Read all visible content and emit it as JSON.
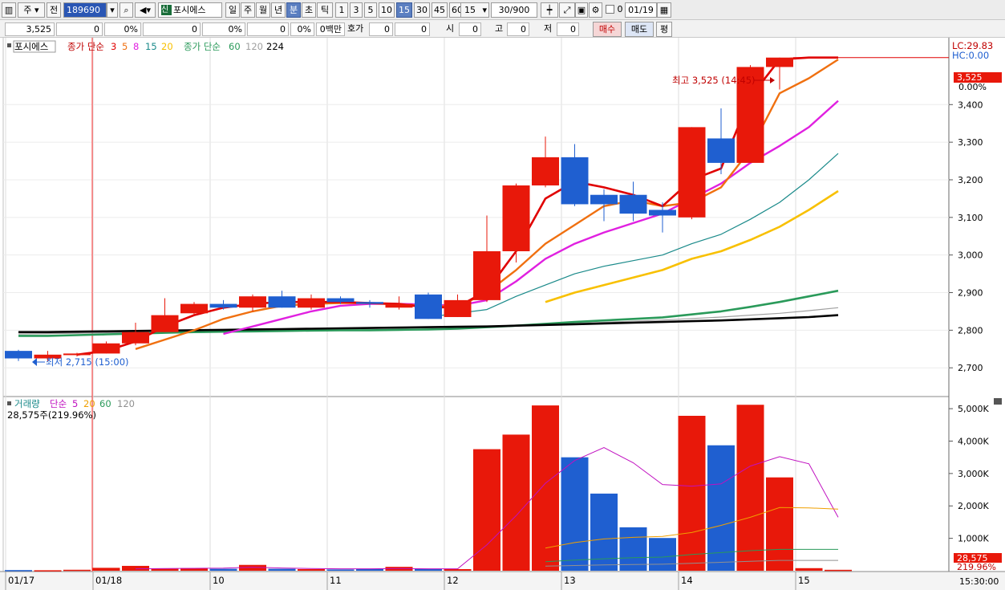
{
  "toolbar": {
    "market": "주",
    "market_mode": "전",
    "code": "189690",
    "name_badge": "신",
    "name": "포시에스",
    "periods": [
      "일",
      "주",
      "월",
      "년",
      "분",
      "초",
      "틱"
    ],
    "active_period": "분",
    "intervals": [
      "1",
      "3",
      "5",
      "10",
      "15",
      "30",
      "45",
      "60"
    ],
    "active_interval": "15",
    "interval_select": "15",
    "count": "30",
    "count_total": "/900",
    "date_checkbox_label": "0",
    "date": "01/19"
  },
  "quote": {
    "price": "3,525",
    "change": "0",
    "change_pct": "0%",
    "volume": "0",
    "volume_pct": "0%",
    "amount": "0",
    "amount_pct": "0%",
    "amount_unit": "0백만",
    "ask_label": "호가",
    "ask_value": "0",
    "ask_value2": "0",
    "open_label": "시",
    "open": "0",
    "high_label": "고",
    "high": "0",
    "low_label": "저",
    "low": "0",
    "buy_label": "매수",
    "sell_label": "매도",
    "eval_label": "평"
  },
  "legend": {
    "stock": "포시에스",
    "ma_short_label": "종가 단순",
    "ma_short_periods": [
      "3",
      "5",
      "8",
      "15",
      "20"
    ],
    "ma_long_label": "종가 단순",
    "ma_long_periods": [
      "60",
      "120",
      "224"
    ],
    "volume_label": "거래량",
    "volume_ma_label": "단순",
    "volume_ma_periods": [
      "5",
      "20",
      "60",
      "120"
    ],
    "volume_current": "28,575주(219.96%)"
  },
  "axis": {
    "lc": "LC:29.83",
    "hc": "HC:0.00",
    "price_tag": "3,525",
    "pct_tag": "0.00%",
    "volume_tag": "28,575",
    "volume_pct_tag": "219.96%",
    "time_tag": "15:30:00"
  },
  "annotations": {
    "high": "최고 3,525 (14:45)",
    "low": "최저 2,715 (15:00)"
  },
  "colors": {
    "up": "#e8180a",
    "down": "#1f5fd0",
    "ma3": "#e00000",
    "ma5": "#f07010",
    "ma8": "#e020e0",
    "ma15": "#1a8a8a",
    "ma20": "#f8c000",
    "ma60": "#2a9a5a",
    "ma120": "#a0a0a0",
    "ma224": "#000000"
  },
  "chart_data": {
    "type": "candlestick",
    "price_axis": {
      "ylim": [
        2630,
        3565
      ],
      "ticks": [
        2700,
        2800,
        2900,
        3000,
        3100,
        3200,
        3300,
        3400
      ]
    },
    "volume_axis": {
      "ylim": [
        0,
        5300
      ],
      "unit": "K",
      "ticks": [
        1000,
        2000,
        3000,
        4000,
        5000
      ]
    },
    "date_labels": [
      {
        "label": "01/17",
        "index": -0.5
      },
      {
        "label": "01/18",
        "index": 2.5
      },
      {
        "label": "10",
        "index": 6.5
      },
      {
        "label": "11",
        "index": 10.5
      },
      {
        "label": "12",
        "index": 14.5
      },
      {
        "label": "13",
        "index": 18.5
      },
      {
        "label": "14",
        "index": 22.5
      },
      {
        "label": "15",
        "index": 26.5
      }
    ],
    "candles": [
      {
        "o": 2745,
        "h": 2748,
        "l": 2718,
        "c": 2725
      },
      {
        "o": 2725,
        "h": 2745,
        "l": 2718,
        "c": 2735
      },
      {
        "o": 2735,
        "h": 2740,
        "l": 2730,
        "c": 2738
      },
      {
        "o": 2738,
        "h": 2770,
        "l": 2738,
        "c": 2765
      },
      {
        "o": 2765,
        "h": 2820,
        "l": 2760,
        "c": 2795
      },
      {
        "o": 2795,
        "h": 2885,
        "l": 2795,
        "c": 2840
      },
      {
        "o": 2845,
        "h": 2875,
        "l": 2840,
        "c": 2870
      },
      {
        "o": 2870,
        "h": 2880,
        "l": 2855,
        "c": 2860
      },
      {
        "o": 2860,
        "h": 2895,
        "l": 2850,
        "c": 2890
      },
      {
        "o": 2890,
        "h": 2905,
        "l": 2860,
        "c": 2860
      },
      {
        "o": 2860,
        "h": 2895,
        "l": 2855,
        "c": 2885
      },
      {
        "o": 2885,
        "h": 2890,
        "l": 2870,
        "c": 2875
      },
      {
        "o": 2875,
        "h": 2880,
        "l": 2860,
        "c": 2870
      },
      {
        "o": 2860,
        "h": 2890,
        "l": 2855,
        "c": 2870
      },
      {
        "o": 2895,
        "h": 2900,
        "l": 2830,
        "c": 2830
      },
      {
        "o": 2835,
        "h": 2895,
        "l": 2835,
        "c": 2880
      },
      {
        "o": 2880,
        "h": 3105,
        "l": 2875,
        "c": 3010
      },
      {
        "o": 3010,
        "h": 3190,
        "l": 2980,
        "c": 3185
      },
      {
        "o": 3185,
        "h": 3315,
        "l": 3180,
        "c": 3260
      },
      {
        "o": 3260,
        "h": 3295,
        "l": 3130,
        "c": 3135
      },
      {
        "o": 3160,
        "h": 3175,
        "l": 3090,
        "c": 3135
      },
      {
        "o": 3160,
        "h": 3195,
        "l": 3090,
        "c": 3110
      },
      {
        "o": 3120,
        "h": 3140,
        "l": 3060,
        "c": 3105
      },
      {
        "o": 3100,
        "h": 3340,
        "l": 3095,
        "c": 3340
      },
      {
        "o": 3310,
        "h": 3390,
        "l": 3215,
        "c": 3245
      },
      {
        "o": 3245,
        "h": 3505,
        "l": 3245,
        "c": 3500
      },
      {
        "o": 3500,
        "h": 3525,
        "l": 3440,
        "c": 3525
      }
    ],
    "volumes": [
      20,
      15,
      30,
      90,
      150,
      60,
      80,
      60,
      180,
      60,
      50,
      40,
      50,
      120,
      60,
      50,
      3750,
      4200,
      5100,
      3500,
      2380,
      1340,
      1010,
      4780,
      3870,
      5120,
      2880,
      80,
      28.575
    ],
    "ma": [
      {
        "period": 3,
        "values": [
          null,
          null,
          2735,
          2745,
          2770,
          2810,
          2840,
          2860,
          2870,
          2875,
          2875,
          2875,
          2872,
          2870,
          2860,
          2862,
          2905,
          3010,
          3150,
          3195,
          3180,
          3160,
          3130,
          3200,
          3230,
          3420,
          3520,
          3525,
          3525
        ]
      },
      {
        "period": 5,
        "values": [
          null,
          null,
          null,
          null,
          2750,
          2775,
          2800,
          2830,
          2850,
          2865,
          2870,
          2872,
          2872,
          2868,
          2865,
          2862,
          2900,
          2960,
          3030,
          3080,
          3130,
          3145,
          3130,
          3140,
          3180,
          3280,
          3430,
          3470,
          3520
        ]
      },
      {
        "period": 8,
        "values": [
          null,
          null,
          null,
          null,
          null,
          null,
          null,
          2790,
          2810,
          2830,
          2850,
          2865,
          2870,
          2870,
          2868,
          2865,
          2880,
          2930,
          2990,
          3030,
          3060,
          3085,
          3110,
          3150,
          3190,
          3245,
          3290,
          3340,
          3410
        ]
      },
      {
        "period": 15,
        "values": [
          null,
          null,
          null,
          null,
          null,
          null,
          null,
          null,
          null,
          null,
          null,
          null,
          null,
          null,
          2835,
          2845,
          2855,
          2890,
          2920,
          2950,
          2970,
          2985,
          3000,
          3030,
          3055,
          3095,
          3140,
          3200,
          3270
        ]
      },
      {
        "period": 20,
        "values": [
          null,
          null,
          null,
          null,
          null,
          null,
          null,
          null,
          null,
          null,
          null,
          null,
          null,
          null,
          null,
          null,
          null,
          null,
          2875,
          2900,
          2920,
          2940,
          2960,
          2990,
          3010,
          3040,
          3075,
          3120,
          3170
        ]
      },
      {
        "period": 60,
        "values": [
          2785,
          2785,
          2787,
          2789,
          2791,
          2793,
          2795,
          2796,
          2797,
          2798,
          2799,
          2800,
          2800,
          2801,
          2802,
          2804,
          2808,
          2812,
          2817,
          2822,
          2826,
          2830,
          2834,
          2842,
          2850,
          2862,
          2875,
          2890,
          2905
        ]
      },
      {
        "period": 120,
        "values": [
          2790,
          2791,
          2792,
          2793,
          2794,
          2796,
          2798,
          2800,
          2801,
          2802,
          2803,
          2804,
          2805,
          2806,
          2807,
          2808,
          2810,
          2812,
          2815,
          2818,
          2821,
          2824,
          2827,
          2831,
          2835,
          2840,
          2845,
          2852,
          2860
        ]
      },
      {
        "period": 224,
        "values": [
          2795,
          2795,
          2796,
          2797,
          2798,
          2799,
          2800,
          2801,
          2802,
          2803,
          2804,
          2805,
          2806,
          2807,
          2808,
          2809,
          2810,
          2812,
          2814,
          2816,
          2818,
          2820,
          2822,
          2824,
          2826,
          2829,
          2832,
          2835,
          2840
        ]
      }
    ],
    "volume_ma": [
      {
        "period": 5,
        "values": [
          null,
          null,
          null,
          null,
          60,
          70,
          75,
          80,
          110,
          85,
          70,
          60,
          60,
          70,
          60,
          60,
          800,
          1700,
          2700,
          3400,
          3800,
          3330,
          2660,
          2610,
          2680,
          3230,
          3520,
          3300,
          1650
        ]
      },
      {
        "period": 20,
        "values": [
          null,
          null,
          null,
          null,
          null,
          null,
          null,
          null,
          null,
          null,
          null,
          null,
          null,
          null,
          null,
          null,
          null,
          null,
          700,
          870,
          980,
          1030,
          1060,
          1180,
          1400,
          1650,
          1950,
          1940,
          1900
        ]
      },
      {
        "period": 60,
        "values": [
          null,
          null,
          null,
          null,
          null,
          null,
          null,
          null,
          null,
          null,
          null,
          null,
          null,
          null,
          null,
          null,
          null,
          null,
          280,
          330,
          370,
          400,
          420,
          500,
          560,
          620,
          660,
          660,
          660
        ]
      },
      {
        "period": 120,
        "values": [
          null,
          null,
          null,
          null,
          null,
          null,
          null,
          null,
          null,
          null,
          null,
          null,
          null,
          null,
          null,
          null,
          null,
          null,
          140,
          160,
          180,
          190,
          200,
          230,
          260,
          290,
          320,
          320,
          320
        ]
      }
    ]
  }
}
